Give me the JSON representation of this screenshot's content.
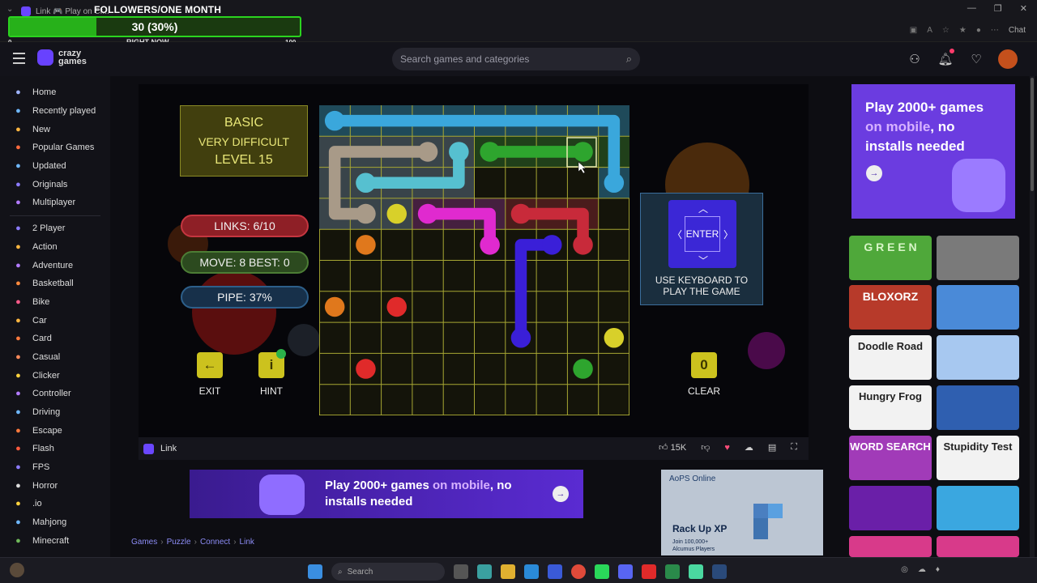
{
  "browser": {
    "tab_title": "Link 🎮 Play on Cr...",
    "chat_label": "Chat"
  },
  "overlay": {
    "title": "FOLLOWERS/ONE MONTH",
    "value_text": "30 (30%)",
    "progress": 0.3,
    "min_label": "0",
    "now_label": "RIGHT NOW",
    "max_label": "100"
  },
  "header": {
    "logo_text": "crazy games",
    "search_placeholder": "Search games and categories",
    "notification_count": "1"
  },
  "sidebar": {
    "items": [
      {
        "label": "Home",
        "icon": "home-icon",
        "color": "#9fb4ff"
      },
      {
        "label": "Recently played",
        "icon": "history-icon",
        "color": "#6fb8ff"
      },
      {
        "label": "New",
        "icon": "new-icon",
        "color": "#ffb640"
      },
      {
        "label": "Popular Games",
        "icon": "fire-icon",
        "color": "#ff6a3d"
      },
      {
        "label": "Updated",
        "icon": "refresh-icon",
        "color": "#6fb8ff"
      },
      {
        "label": "Originals",
        "icon": "originals-icon",
        "color": "#8c7bff"
      },
      {
        "label": "Multiplayer",
        "icon": "multiplayer-icon",
        "color": "#b37bff"
      }
    ],
    "categories": [
      {
        "label": "2 Player",
        "icon": "two-player-icon",
        "color": "#8c7bff"
      },
      {
        "label": "Action",
        "icon": "sword-icon",
        "color": "#ffb640"
      },
      {
        "label": "Adventure",
        "icon": "compass-icon",
        "color": "#b37bff"
      },
      {
        "label": "Basketball",
        "icon": "basketball-icon",
        "color": "#ff8a3d"
      },
      {
        "label": "Bike",
        "icon": "bike-icon",
        "color": "#ff5a8a"
      },
      {
        "label": "Car",
        "icon": "car-icon",
        "color": "#ffb640"
      },
      {
        "label": "Card",
        "icon": "card-icon",
        "color": "#ff7a3d"
      },
      {
        "label": "Casual",
        "icon": "casual-icon",
        "color": "#ff8a5a"
      },
      {
        "label": "Clicker",
        "icon": "clicker-icon",
        "color": "#ffd23d"
      },
      {
        "label": "Controller",
        "icon": "controller-icon",
        "color": "#b37bff"
      },
      {
        "label": "Driving",
        "icon": "driving-icon",
        "color": "#6fb8ff"
      },
      {
        "label": "Escape",
        "icon": "escape-icon",
        "color": "#ff7a3d"
      },
      {
        "label": "Flash",
        "icon": "flash-icon",
        "color": "#ff5a3d"
      },
      {
        "label": "FPS",
        "icon": "fps-icon",
        "color": "#8c7bff"
      },
      {
        "label": "Horror",
        "icon": "horror-icon",
        "color": "#dddddd"
      },
      {
        "label": ".io",
        "icon": "io-icon",
        "color": "#ffd23d"
      },
      {
        "label": "Mahjong",
        "icon": "mahjong-icon",
        "color": "#6fb8ff"
      },
      {
        "label": "Minecraft",
        "icon": "minecraft-icon",
        "color": "#6fb85a"
      }
    ]
  },
  "game": {
    "mode": "BASIC",
    "difficulty": "VERY DIFFICULT",
    "level_label": "LEVEL  15",
    "links": "LINKS:  6/10",
    "move_best": "MOVE: 8    BEST: 0",
    "pipe": "PIPE:  37%",
    "exit_label": "EXIT",
    "hint_label": "HINT",
    "clear_label": "CLEAR",
    "clear_value": "0",
    "enter_label": "ENTER",
    "keyboard_hint_1": "USE KEYBOARD TO",
    "keyboard_hint_2": "PLAY THE GAME"
  },
  "game_toolbar": {
    "title": "Link",
    "likes": "15K"
  },
  "banner": {
    "line1_pre": "Play 2000+ games ",
    "line1_hl": "on mobile",
    "line1_post": ", no",
    "line2": "installs needed"
  },
  "aops": {
    "brand": "AoPS Online",
    "headline": "Rack Up XP",
    "sub1": "Join 100,000+",
    "sub2": "Alcumus Players"
  },
  "breadcrumb": [
    "Games",
    "Puzzle",
    "Connect",
    "Link"
  ],
  "right_promo": {
    "line1": "Play 2000+ games",
    "line2_hl": "on mobile",
    "line2_post": ", no",
    "line3": "installs needed"
  },
  "thumbnails": [
    {
      "label": "G R E E N",
      "bg": "#4fa83a",
      "fg": "#d8f5c8"
    },
    {
      "label": "",
      "bg": "#7a7a7a",
      "fg": "#ffffff"
    },
    {
      "label": "BLOXORZ",
      "bg": "#b73a2a",
      "fg": "#ffffff"
    },
    {
      "label": "",
      "bg": "#4a8ad8",
      "fg": "#ffffff"
    },
    {
      "label": "Doodle Road",
      "bg": "#f2f2f2",
      "fg": "#222222"
    },
    {
      "label": "",
      "bg": "#a7c8f0",
      "fg": "#ffffff"
    },
    {
      "label": "Hungry Frog",
      "bg": "#f2f2f2",
      "fg": "#222222"
    },
    {
      "label": "",
      "bg": "#2f5fb0",
      "fg": "#ffffff"
    },
    {
      "label": "WORD SEARCH",
      "bg": "#a13bb8",
      "fg": "#ffffff"
    },
    {
      "label": "Stupidity Test",
      "bg": "#f2f2f2",
      "fg": "#222222"
    },
    {
      "label": "",
      "bg": "#6a1fa8",
      "fg": "#ffffff"
    },
    {
      "label": "",
      "bg": "#3aa7e0",
      "fg": "#ffffff"
    },
    {
      "label": "",
      "bg": "#d83a8a",
      "fg": "#ffffff"
    },
    {
      "label": "",
      "bg": "#d83a8a",
      "fg": "#ffffff"
    }
  ],
  "taskbar": {
    "search_label": "Search"
  }
}
